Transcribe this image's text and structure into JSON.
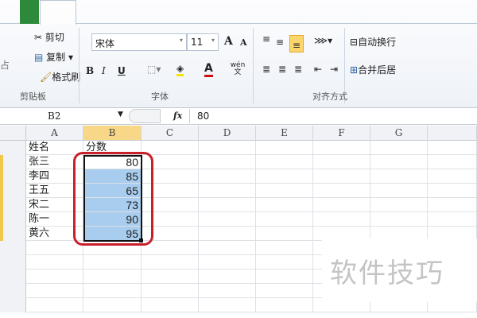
{
  "clipboard": {
    "paste_partial": "占",
    "cut": "剪切",
    "copy": "复制",
    "format_painter": "格式刷",
    "group_label": "剪贴板"
  },
  "font": {
    "name": "宋体",
    "size": "11",
    "bold": "B",
    "italic": "I",
    "underline": "U",
    "group_label": "字体",
    "grow": "A",
    "shrink": "A",
    "phonetic": "wén 文"
  },
  "alignment": {
    "wrap_text": "自动换行",
    "merge_center": "合并后居",
    "group_label": "对齐方式"
  },
  "formula_bar": {
    "name_box": "B2",
    "fx": "fx",
    "value": "80"
  },
  "columns": [
    "A",
    "B",
    "C",
    "D",
    "E",
    "F",
    "G"
  ],
  "rows": [
    [
      "姓名",
      "分数"
    ],
    [
      "张三",
      "80"
    ],
    [
      "李四",
      "85"
    ],
    [
      "王五",
      "65"
    ],
    [
      "宋二",
      "73"
    ],
    [
      "陈一",
      "90"
    ],
    [
      "黄六",
      "95"
    ]
  ],
  "watermark": "软件技巧",
  "colors": {
    "selection": "#a8cdee",
    "annotation": "#c8202a",
    "active_header": "#f8d888"
  }
}
